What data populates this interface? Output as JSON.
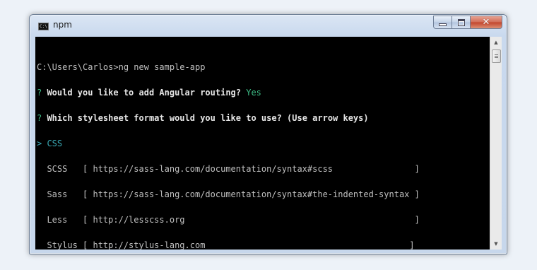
{
  "window": {
    "title": "npm",
    "icon": "console-icon",
    "icon_text": "C:\\"
  },
  "colors": {
    "prompt_marker": "#3dbd86",
    "answer": "#3dbd86",
    "selected_option": "#3aa8b4",
    "text": "#c0c0c0",
    "background": "#000000"
  },
  "console": {
    "command_line": "C:\\Users\\Carlos>ng new sample-app",
    "question1": {
      "marker": "?",
      "text": " Would you like to add Angular routing? ",
      "answer": "Yes"
    },
    "question2": {
      "marker": "?",
      "text": " Which stylesheet format would you like to use? ",
      "hint": "(Use arrow keys)"
    },
    "selected": {
      "pointer": ">",
      "label": " CSS"
    },
    "options": [
      {
        "text": "  SCSS   [ https://sass-lang.com/documentation/syntax#scss                ]"
      },
      {
        "text": "  Sass   [ https://sass-lang.com/documentation/syntax#the-indented-syntax ]"
      },
      {
        "text": "  Less   [ http://lesscss.org                                             ]"
      },
      {
        "text": "  Stylus [ http://stylus-lang.com                                        ]"
      }
    ]
  }
}
